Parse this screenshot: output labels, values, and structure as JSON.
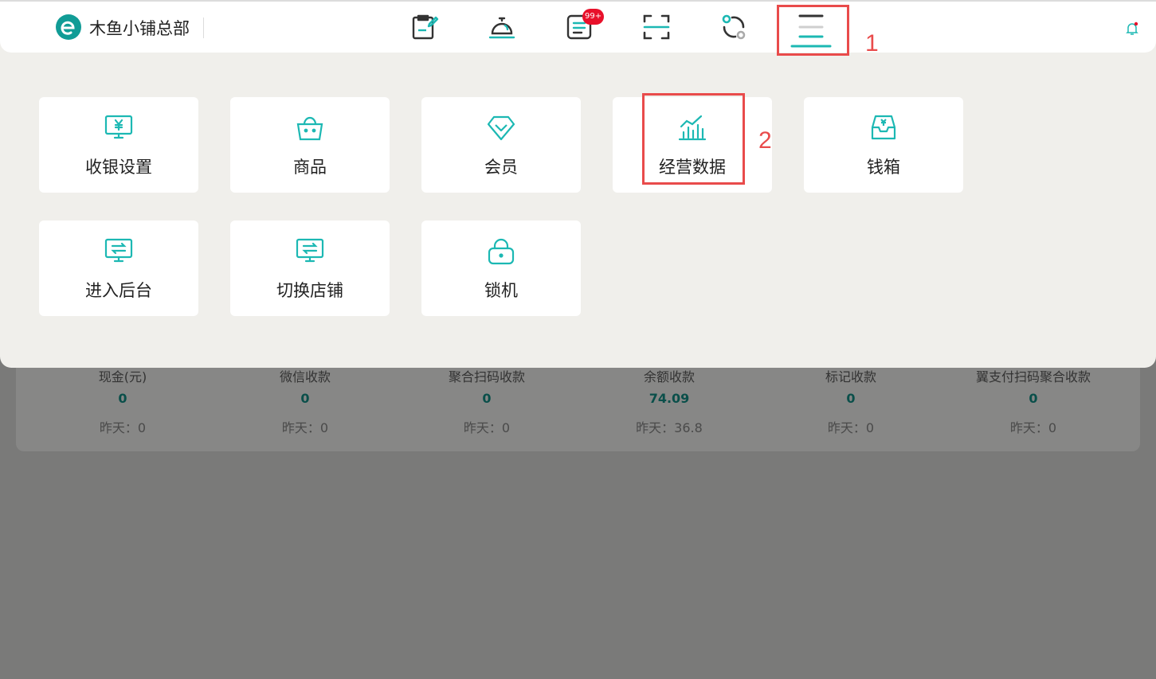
{
  "header": {
    "store_name": "木鱼小铺总部",
    "badge": "99+",
    "nav_icons": [
      "edit-note-icon",
      "service-bell-icon",
      "order-list-icon",
      "scan-icon",
      "exchange-icon",
      "menu-icon"
    ]
  },
  "annotations": {
    "menu": "1",
    "tile": "2"
  },
  "menu_tiles": [
    {
      "label": "收银设置",
      "icon": "cashier-monitor-icon"
    },
    {
      "label": "商品",
      "icon": "shopping-basket-icon"
    },
    {
      "label": "会员",
      "icon": "diamond-icon"
    },
    {
      "label": "经营数据",
      "icon": "bar-chart-icon"
    },
    {
      "label": "钱箱",
      "icon": "cash-box-icon"
    },
    {
      "label": "进入后台",
      "icon": "backend-monitor-icon"
    },
    {
      "label": "切换店铺",
      "icon": "switch-store-icon"
    },
    {
      "label": "锁机",
      "icon": "lock-icon"
    }
  ],
  "stats": [
    {
      "label": "现金(元)",
      "value": "0",
      "yesterday": "昨天：0"
    },
    {
      "label": "微信收款",
      "value": "0",
      "yesterday": "昨天：0"
    },
    {
      "label": "聚合扫码收款",
      "value": "0",
      "yesterday": "昨天：0"
    },
    {
      "label": "余额收款",
      "value": "74.09",
      "yesterday": "昨天：36.8"
    },
    {
      "label": "标记收款",
      "value": "0",
      "yesterday": "昨天：0"
    },
    {
      "label": "翼支付扫码聚合收款",
      "value": "0",
      "yesterday": "昨天：0"
    }
  ],
  "colors": {
    "accent": "#1cb8b3",
    "annotation": "#e94b4b",
    "badge": "#e8102a"
  }
}
